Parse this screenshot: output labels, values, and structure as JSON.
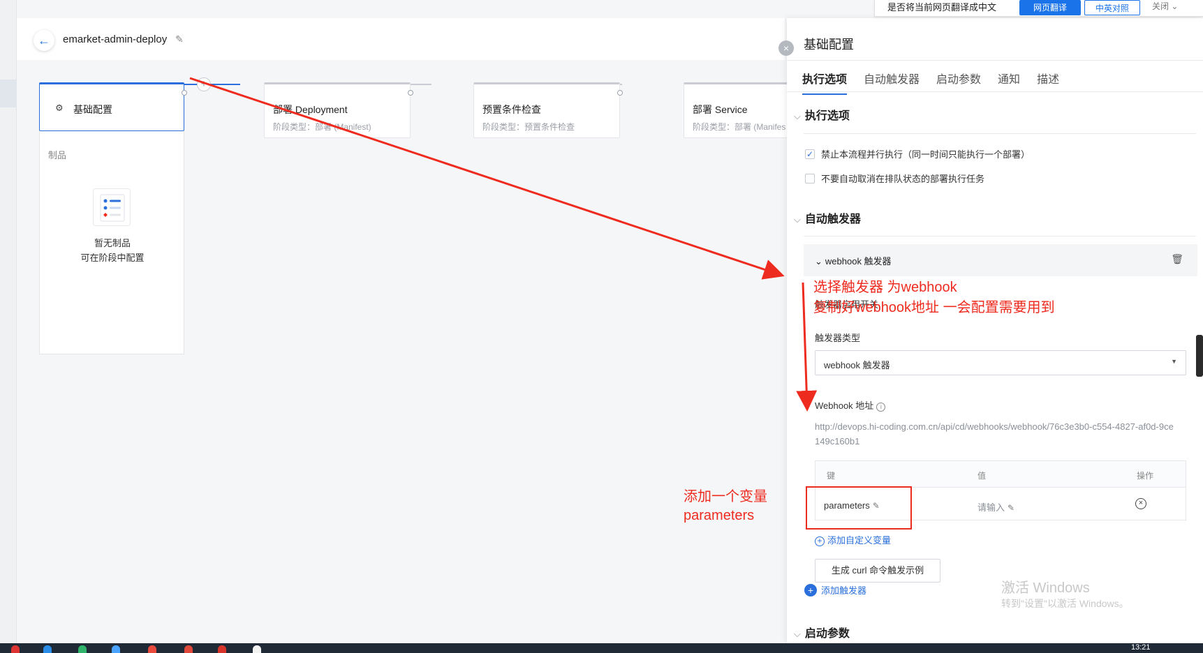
{
  "pipeline": {
    "name": "emarket-admin-deploy"
  },
  "stages": [
    {
      "title": "基础配置",
      "subtitle": ""
    },
    {
      "title": "部署 Deployment",
      "subtitle": "阶段类型：部署 (Manifest)"
    },
    {
      "title": "预置条件检查",
      "subtitle": "阶段类型：预置条件检查"
    },
    {
      "title": "部署 Service",
      "subtitle": "阶段类型：部署 (Manifes"
    }
  ],
  "artifacts": {
    "label": "制品",
    "empty_line1": "暂无制品",
    "empty_line2": "可在阶段中配置"
  },
  "drawer": {
    "title": "基础配置",
    "tabs": [
      "执行选项",
      "自动触发器",
      "启动参数",
      "通知",
      "描述"
    ],
    "exec_section": "执行选项",
    "option1": "禁止本流程并行执行（同一时间只能执行一个部署）",
    "option1_checked": true,
    "option2": "不要自动取消在排队状态的部署执行任务",
    "option2_checked": false,
    "trigger_section": "自动触发器",
    "trigger_name": "webhook 触发器",
    "trigger_switch_label": "触发器启用开关",
    "trigger_type_label": "触发器类型",
    "trigger_type_value": "webhook 触发器",
    "webhook_label": "Webhook 地址",
    "webhook_url": "http://devops.hi-coding.com.cn/api/cd/webhooks/webhook/76c3e3b0-c554-4827-af0d-9ce149c160b1",
    "table_headers": {
      "key": "键",
      "value": "值",
      "action": "操作"
    },
    "variable_key": "parameters",
    "variable_value_placeholder": "请输入",
    "add_variable": "添加自定义变量",
    "curl_button": "生成 curl 命令触发示例",
    "add_trigger": "添加触发器",
    "params_section": "启动参数"
  },
  "translate_bar": {
    "prompt": "是否将当前网页翻译成中文",
    "translate": "网页翻译",
    "compare": "中英对照",
    "close": "关闭"
  },
  "annotations": {
    "line1": "选择触发器  为webhook",
    "line2": "复制好webhook地址 一会配置需要用到",
    "var_line1": "添加一个变量",
    "var_line2": "parameters",
    "color": "#ee2b1f"
  },
  "watermark": {
    "title": "激活 Windows",
    "subtitle": "转到\"设置\"以激活 Windows。"
  },
  "taskbar": {
    "clock": "13:21"
  },
  "colors": {
    "primary": "#2a6fdb",
    "annotation": "#ee2b1f"
  }
}
